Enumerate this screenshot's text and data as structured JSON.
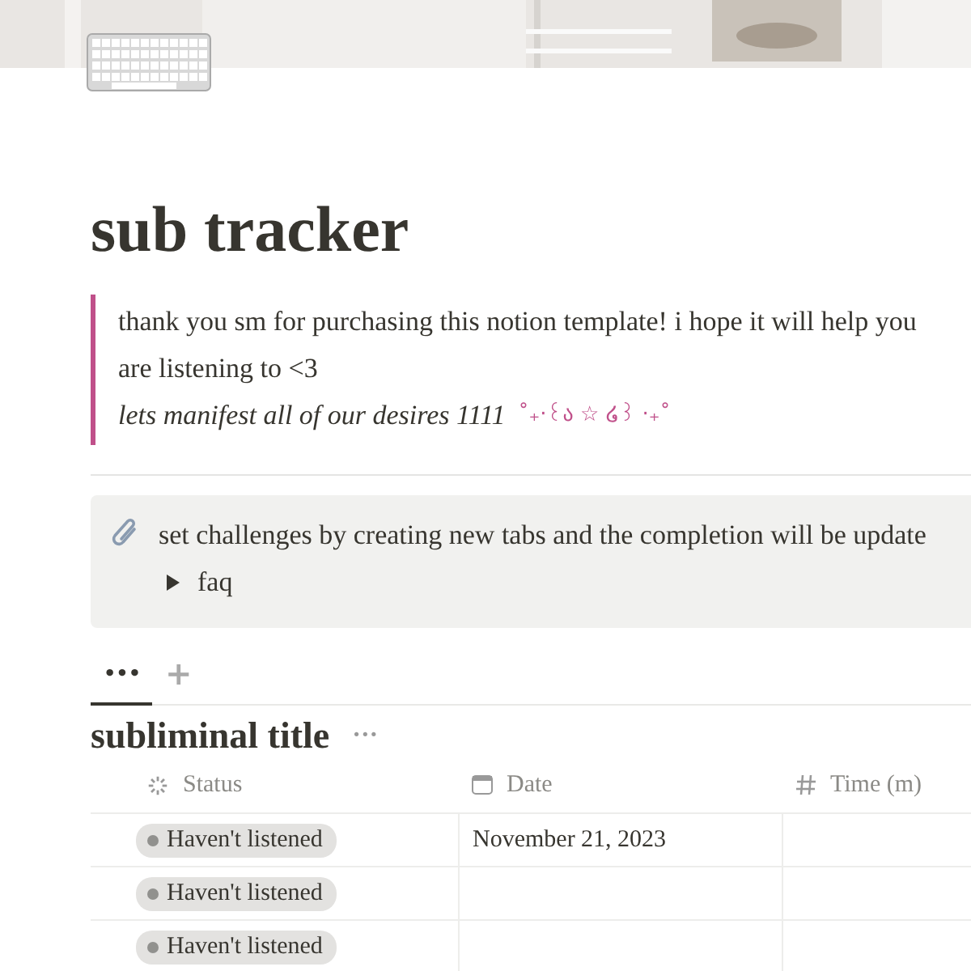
{
  "title": "sub tracker",
  "quote": {
    "lines": [
      "thank you sm for purchasing this notion template! i hope it will help you",
      "are listening to <3"
    ],
    "italic_line": "lets manifest all of our desires 1111",
    "decoration": "˚₊‧꒰ა ☆ ໒꒱ ‧₊˚"
  },
  "callout": {
    "text": "set challenges by creating new tabs and the completion will be update",
    "toggle": {
      "label": "faq",
      "expanded": false
    }
  },
  "view_tabs": [
    {
      "label": "•••",
      "selected": true
    },
    {
      "label": "+",
      "selected": false
    }
  ],
  "database": {
    "title": "subliminal title",
    "menu": "···",
    "columns": [
      {
        "label": "Status",
        "kind": "status"
      },
      {
        "label": "Date",
        "kind": "date"
      },
      {
        "label": "Time (m)",
        "kind": "number"
      }
    ],
    "rows": [
      {
        "status": "Haven't listened",
        "date": "November 21, 2023"
      },
      {
        "status": "Haven't listened"
      },
      {
        "status": "Haven't listened"
      }
    ]
  }
}
